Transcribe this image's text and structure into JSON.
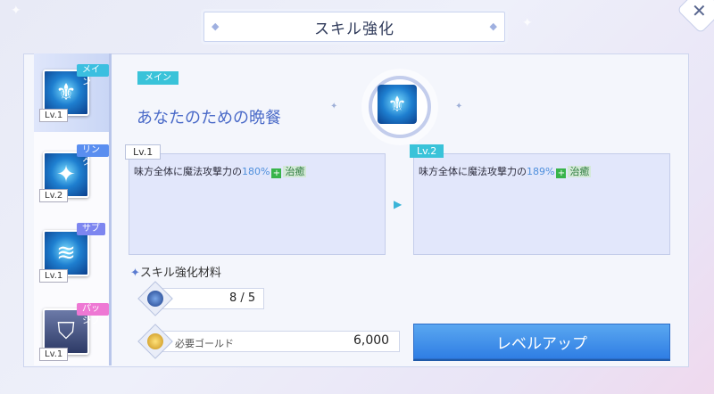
{
  "header": {
    "title": "スキル強化",
    "close_icon": "close-icon"
  },
  "sidebar": {
    "items": [
      {
        "tag": "メイン",
        "level": "Lv.1",
        "icon": "fleur-staff-icon",
        "tag_color": "#3bbfe0"
      },
      {
        "tag": "リンク",
        "level": "Lv.2",
        "icon": "sparkle-icon",
        "tag_color": "#5a8ef0"
      },
      {
        "tag": "サブ",
        "level": "Lv.1",
        "icon": "wave-icon",
        "tag_color": "#7d86f0"
      },
      {
        "tag": "パッシブ",
        "level": "Lv.1",
        "icon": "shield-icon",
        "tag_color": "#ee78d4"
      }
    ]
  },
  "skill": {
    "type_tag": "メイン",
    "name": "あなたのための晩餐",
    "current": {
      "level": "Lv.1",
      "desc_prefix": "味方全体に魔法攻撃力の",
      "percent": "180%",
      "effect": "治癒"
    },
    "next": {
      "level": "Lv.2",
      "desc_prefix": "味方全体に魔法攻撃力の",
      "percent": "189%",
      "effect": "治癒"
    }
  },
  "materials": {
    "title": "スキル強化材料",
    "item_qty": "8 / 5",
    "gold_label": "必要ゴールド",
    "gold_value": "6,000"
  },
  "actions": {
    "levelup_label": "レベルアップ"
  },
  "colors": {
    "accent": "#39c3d9",
    "button": "#2f7ee4",
    "skill_name": "#4a6ac8"
  }
}
